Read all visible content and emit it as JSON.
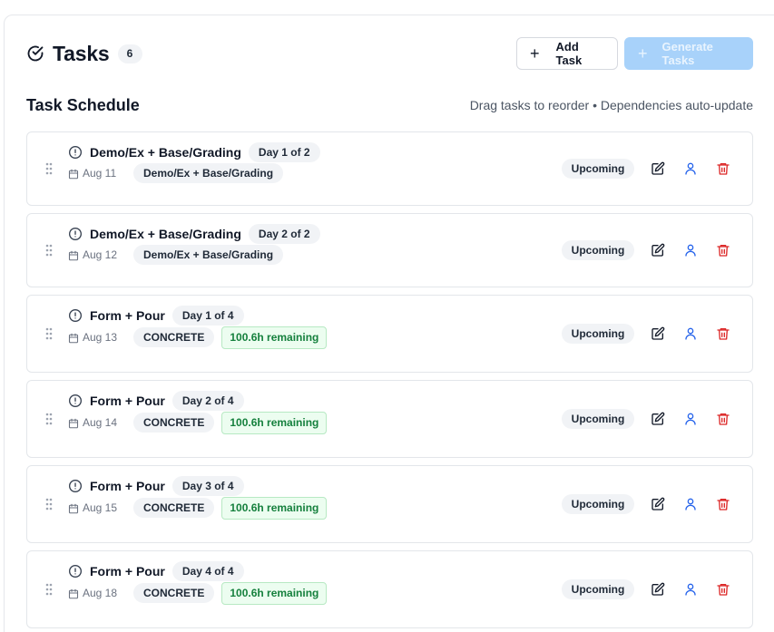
{
  "header": {
    "title": "Tasks",
    "count": "6",
    "add_label": "Add Task",
    "generate_label": "Generate Tasks",
    "title_icon": "check-circle-icon"
  },
  "schedule": {
    "title": "Task Schedule",
    "hint": "Drag tasks to reorder • Dependencies auto-update"
  },
  "colors": {
    "primary_disabled": "#a8d2fa",
    "assign_icon": "#2563eb",
    "delete_icon": "#dc2626",
    "remaining_text": "#15803d"
  },
  "tasks": [
    {
      "name": "Demo/Ex + Base/Grading",
      "day": "Day 1 of 2",
      "date": "Aug 11",
      "trade": "Demo/Ex + Base/Grading",
      "remaining": "",
      "status": "Upcoming"
    },
    {
      "name": "Demo/Ex + Base/Grading",
      "day": "Day 2 of 2",
      "date": "Aug 12",
      "trade": "Demo/Ex + Base/Grading",
      "remaining": "",
      "status": "Upcoming"
    },
    {
      "name": "Form + Pour",
      "day": "Day 1 of 4",
      "date": "Aug 13",
      "trade": "CONCRETE",
      "remaining": "100.6h remaining",
      "status": "Upcoming"
    },
    {
      "name": "Form + Pour",
      "day": "Day 2 of 4",
      "date": "Aug 14",
      "trade": "CONCRETE",
      "remaining": "100.6h remaining",
      "status": "Upcoming"
    },
    {
      "name": "Form + Pour",
      "day": "Day 3 of 4",
      "date": "Aug 15",
      "trade": "CONCRETE",
      "remaining": "100.6h remaining",
      "status": "Upcoming"
    },
    {
      "name": "Form + Pour",
      "day": "Day 4 of 4",
      "date": "Aug 18",
      "trade": "CONCRETE",
      "remaining": "100.6h remaining",
      "status": "Upcoming"
    }
  ]
}
